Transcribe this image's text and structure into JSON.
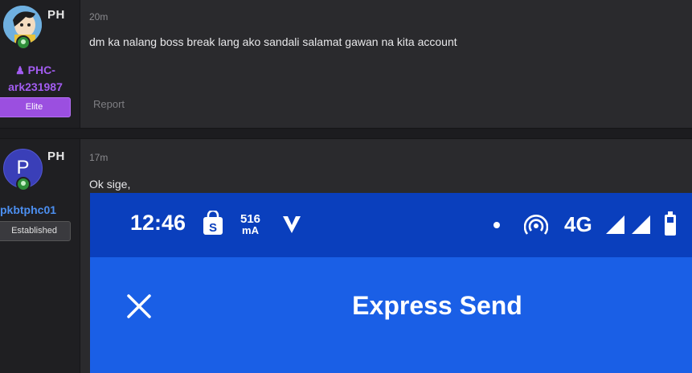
{
  "posts": [
    {
      "country": "PH",
      "username": "PHC-ark231987",
      "username_visible": "ark231987",
      "username_prefix": "PHC-",
      "rank": "Elite",
      "time": "20m",
      "message": "dm ka nalang boss break lang ako sandali salamat gawan na kita account",
      "report_label": "Report"
    },
    {
      "country": "PH",
      "avatar_letter": "P",
      "username": "pkbtphc01",
      "rank": "Established",
      "time": "17m",
      "message": "Ok sige,"
    }
  ],
  "phone": {
    "clock": "12:46",
    "current_value": "516",
    "current_unit": "mA",
    "network": "4G",
    "title": "Express Send",
    "close_icon": "close-icon"
  },
  "colors": {
    "elite": "#9b4fe0",
    "phone_blue": "#1a5fe6",
    "status_blue": "#0a3fbd"
  }
}
